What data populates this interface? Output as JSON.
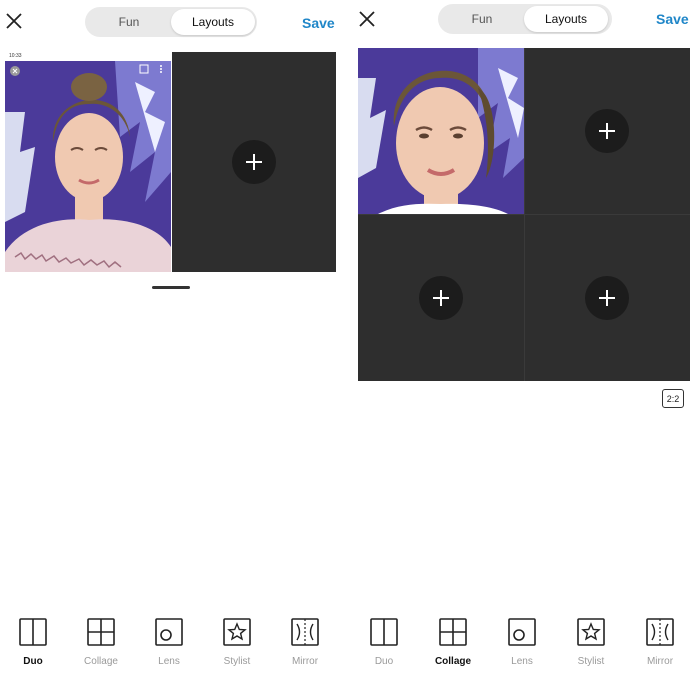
{
  "left_panel": {
    "tabs": [
      {
        "label": "Fun",
        "active": false
      },
      {
        "label": "Layouts",
        "active": true
      }
    ],
    "save_label": "Save",
    "status_time": "10:33",
    "tools": [
      {
        "label": "Duo",
        "icon": "duo-layout-icon",
        "active": true
      },
      {
        "label": "Collage",
        "icon": "collage-layout-icon",
        "active": false
      },
      {
        "label": "Lens",
        "icon": "lens-layout-icon",
        "active": false
      },
      {
        "label": "Stylist",
        "icon": "stylist-star-icon",
        "active": false
      },
      {
        "label": "Mirror",
        "icon": "mirror-layout-icon",
        "active": false
      }
    ]
  },
  "right_panel": {
    "tabs": [
      {
        "label": "Fun",
        "active": false
      },
      {
        "label": "Layouts",
        "active": true
      }
    ],
    "save_label": "Save",
    "ratio_label": "2:2",
    "tools": [
      {
        "label": "Duo",
        "icon": "duo-layout-icon",
        "active": false
      },
      {
        "label": "Collage",
        "icon": "collage-layout-icon",
        "active": true
      },
      {
        "label": "Lens",
        "icon": "lens-layout-icon",
        "active": false
      },
      {
        "label": "Stylist",
        "icon": "stylist-star-icon",
        "active": false
      },
      {
        "label": "Mirror",
        "icon": "mirror-layout-icon",
        "active": false
      }
    ]
  },
  "colors": {
    "accent": "#1f86c8",
    "empty_cell": "#2e2e2e",
    "add_button": "#1c1c1c",
    "inactive_label": "#9a9a9a"
  }
}
